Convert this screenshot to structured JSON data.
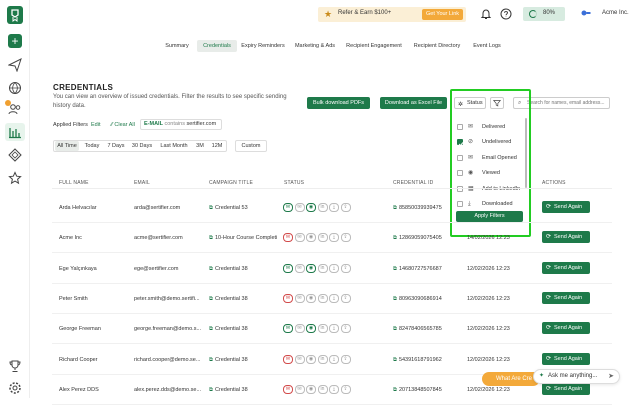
{
  "topbar": {
    "refer_label": "Refer & Earn $100+",
    "get_link_label": "Get Your Link",
    "progress_label": "80%",
    "progress_value": 0.8,
    "org_name": "Acme Inc."
  },
  "tabs": [
    {
      "label": "Summary"
    },
    {
      "label": "Credentials"
    },
    {
      "label": "Expiry Reminders"
    },
    {
      "label": "Marketing & Ads"
    },
    {
      "label": "Recipient Engagement"
    },
    {
      "label": "Recipient Directory"
    },
    {
      "label": "Event Logs"
    }
  ],
  "page": {
    "title": "CREDENTIALS",
    "description": "You can view an overview of issued credentials. Filter the results to see specific sending history data.",
    "bulk_download_label": "Bulk download PDFs",
    "excel_label": "Download as Excel File"
  },
  "filters": {
    "applied_label": "Applied Filters",
    "edit_label": "Edit",
    "clear_label": "Clear All",
    "chip_field": "E-MAIL",
    "chip_op": "contains",
    "chip_value": "sertifier.com",
    "ranges": [
      "All Time",
      "Today",
      "7 Days",
      "30 Days",
      "Last Month",
      "3M",
      "12M"
    ],
    "custom_label": "Custom",
    "status_label": "Status",
    "search_placeholder": "Search for names, email address..."
  },
  "status_dropdown": {
    "items": [
      {
        "label": "Delivered",
        "checked": false
      },
      {
        "label": "Undelivered",
        "checked": true
      },
      {
        "label": "Email Opened",
        "checked": false
      },
      {
        "label": "Viewed",
        "checked": false
      },
      {
        "label": "Add to LinkedIn",
        "checked": false
      },
      {
        "label": "Downloaded",
        "checked": false
      }
    ],
    "apply_label": "Apply Filters"
  },
  "table": {
    "headers": [
      "FULL NAME",
      "EMAIL",
      "CAMPAIGN TITLE",
      "STATUS",
      "CREDENTIAL ID",
      "ACTIONS"
    ],
    "send_label": "Send Again",
    "rows": [
      {
        "name": "Arda Helvacılar",
        "email": "arda@sertifier.com",
        "campaign": "Credential 53",
        "id": "85850039939475",
        "date": "",
        "mail": "g"
      },
      {
        "name": "Acme Inc",
        "email": "acme@sertifier.com",
        "campaign": "10-Hour Course Completi",
        "id": "12869059075405",
        "date": "14/02/2026 12:23",
        "mail": "r"
      },
      {
        "name": "Ege Yalçınkaya",
        "email": "ege@sertifier.com",
        "campaign": "Credential 38",
        "id": "14680727576687",
        "date": "12/02/2026 12:23",
        "mail": "g"
      },
      {
        "name": "Peter Smith",
        "email": "peter.smith@demo.sertifi...",
        "campaign": "Credential 38",
        "id": "80963090686914",
        "date": "12/02/2026 12:23",
        "mail": "r"
      },
      {
        "name": "George Freeman",
        "email": "george.freeman@demo.s...",
        "campaign": "Credential 38",
        "id": "82478406565785",
        "date": "12/02/2026 12:23",
        "mail": "g"
      },
      {
        "name": "Richard Cooper",
        "email": "richard.cooper@demo.se...",
        "campaign": "Credential 38",
        "id": "54391618791962",
        "date": "12/02/2026 12:23",
        "mail": "r"
      },
      {
        "name": "Alex Perez DDS",
        "email": "alex.perez.dds@demo.se...",
        "campaign": "Credential 38",
        "id": "20713848507845",
        "date": "12/02/2026 12:23",
        "mail": "r"
      }
    ]
  },
  "chat": {
    "what_label": "What Are Cre",
    "ask_label": "Ask me anything..."
  }
}
